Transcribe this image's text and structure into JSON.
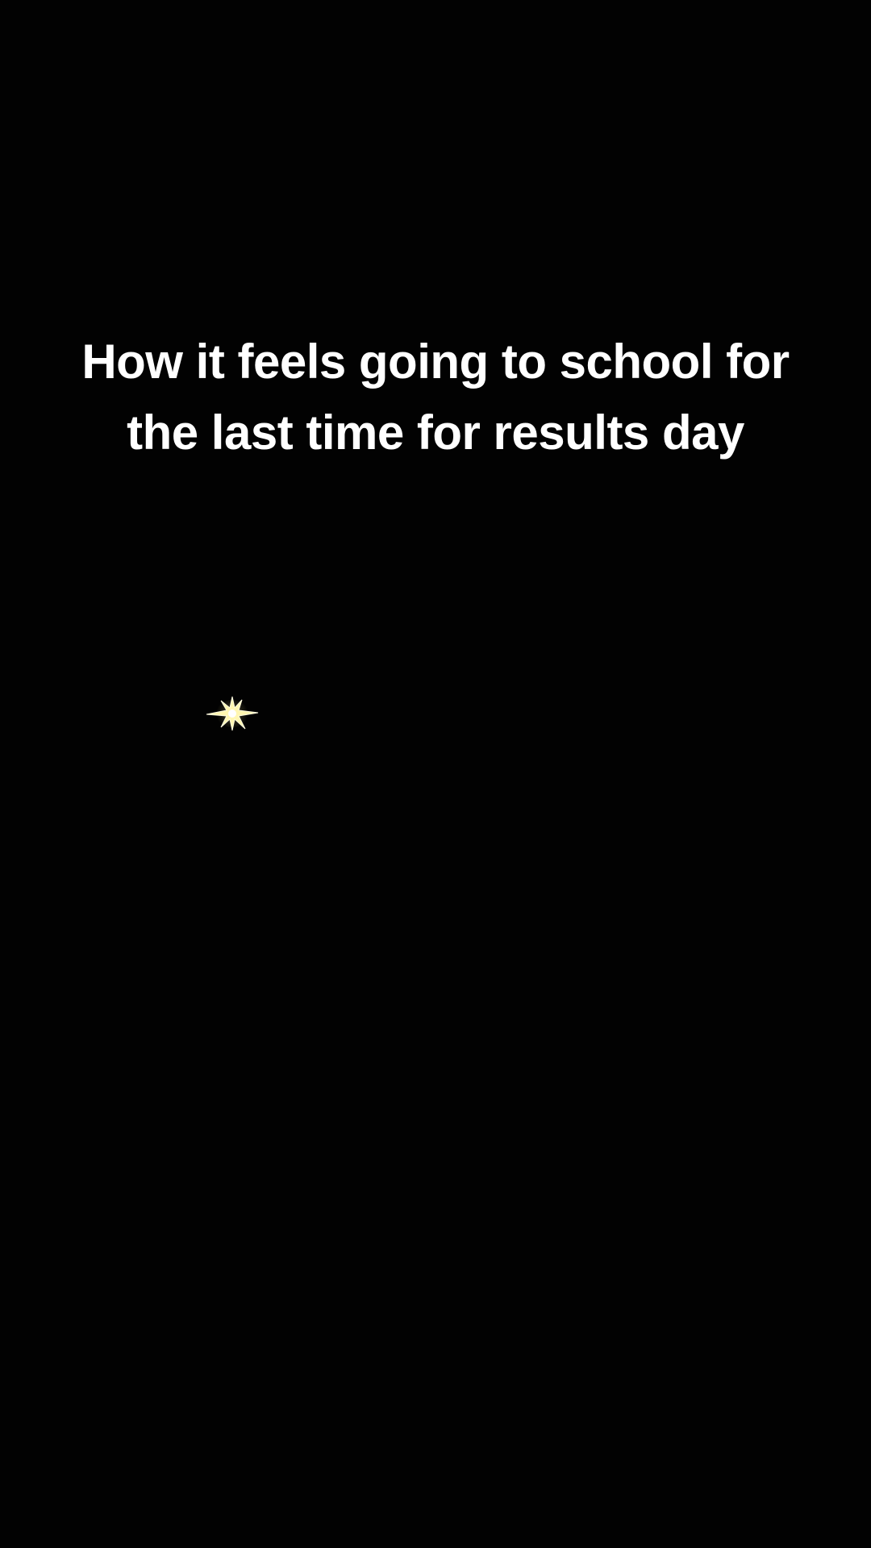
{
  "caption": {
    "line1": "How it feels going to school for",
    "line2": "the last time for results day"
  },
  "sparkle": {
    "icon": "sparkle-icon",
    "color": "#fff6b0"
  },
  "colors": {
    "background": "#020202",
    "text": "#ffffff"
  }
}
